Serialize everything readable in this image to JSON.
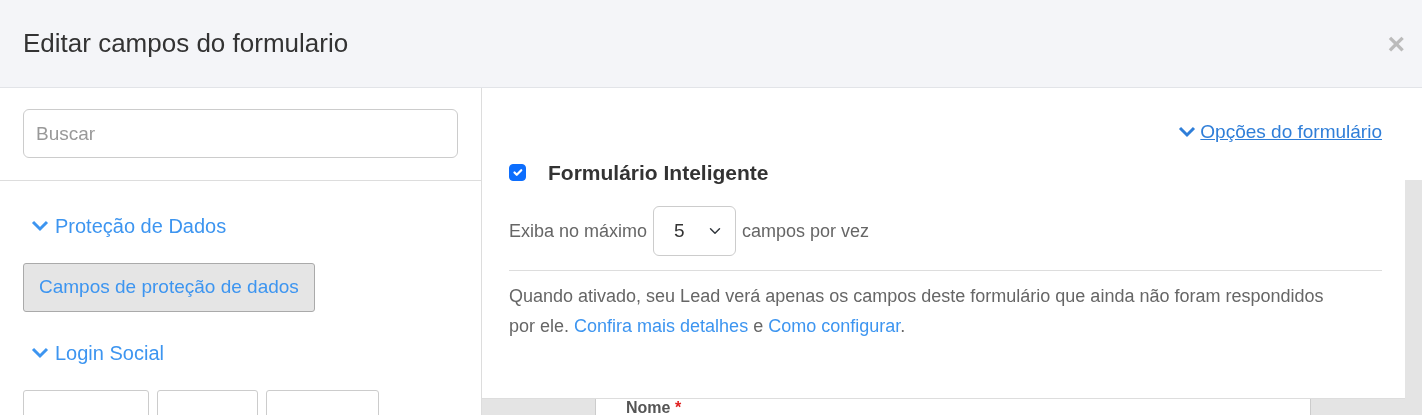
{
  "modal": {
    "title": "Editar campos do formulario",
    "close": "×"
  },
  "search": {
    "placeholder": "Buscar"
  },
  "sections": [
    {
      "title": "Proteção de Dados",
      "expanded": true,
      "items": [
        {
          "kind": "button",
          "label": "Campos de proteção de dados"
        }
      ]
    },
    {
      "title": "Login Social",
      "expanded": true,
      "items": [
        {
          "kind": "cut-button"
        },
        {
          "kind": "cut-button"
        },
        {
          "kind": "cut-button"
        }
      ]
    }
  ],
  "options": {
    "link": "Opções do formulário",
    "expanded": true,
    "smart_form": {
      "label": "Formulário Inteligente",
      "checked": true
    },
    "max_prefix": "Exiba no máximo",
    "max_value": "5",
    "max_suffix": "campos por vez",
    "description": [
      {
        "kind": "text",
        "text": "Quando ativado, seu Lead verá apenas os campos deste formulário que ainda não foram respondidos por ele. "
      },
      {
        "kind": "link",
        "text": "Confira mais detalhes"
      },
      {
        "kind": "text",
        "text": " e "
      },
      {
        "kind": "link",
        "text": "Como configurar"
      },
      {
        "kind": "text",
        "text": "."
      }
    ]
  },
  "preview": {
    "field_label": "Nome",
    "required": true,
    "required_mark": "*"
  }
}
